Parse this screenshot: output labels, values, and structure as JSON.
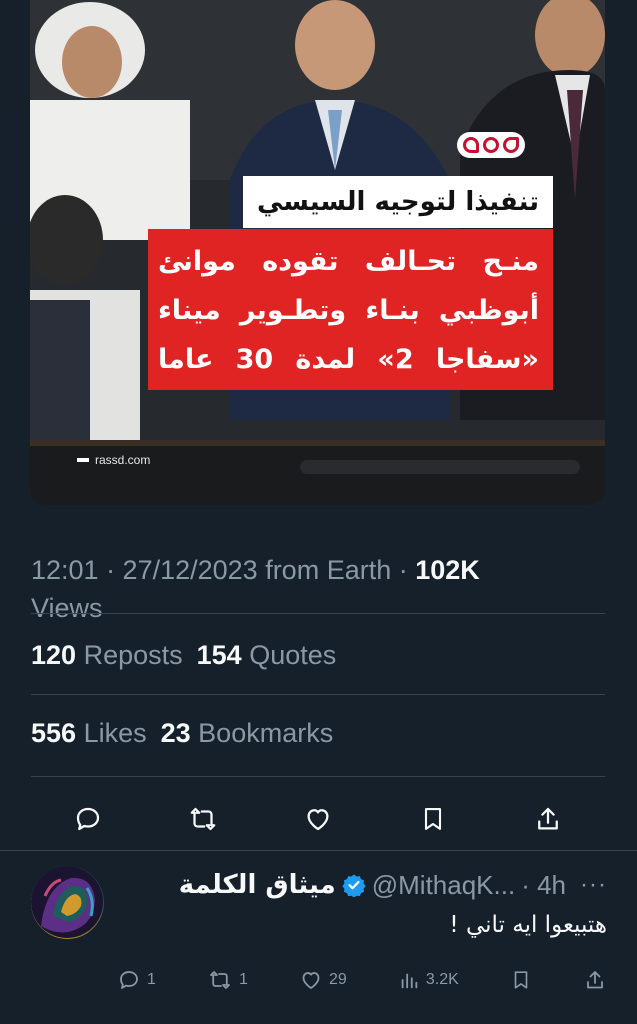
{
  "media": {
    "logo_text": "رصد",
    "headline_tag": "تنفيذا لتوجيه السيسي",
    "body_lines": [
      "منـح تحـالف تقوده موانئ",
      "أبوظبي بنـاء وتطـوير ميناء",
      "«سفاجا 2» لمدة 30 عاما"
    ],
    "watermark": "rassd.com",
    "accent_color": "#e02424"
  },
  "tweet": {
    "timestamp": "12:01 · 27/12/2023 from Earth · ",
    "views_count": "102K",
    "views_label": "Views",
    "reposts_count": "120",
    "reposts_label": "Reposts",
    "quotes_count": "154",
    "quotes_label": "Quotes",
    "likes_count": "556",
    "likes_label": "Likes",
    "bookmarks_count": "23",
    "bookmarks_label": "Bookmarks"
  },
  "action_bar": {
    "icons": [
      "reply-icon",
      "repost-icon",
      "like-icon",
      "bookmark-icon",
      "share-icon"
    ]
  },
  "reply": {
    "name": "ميثاق الكلمة",
    "handle": "@MithaqK...",
    "time": "· 4h",
    "more": "···",
    "text": "هتبيعوا ايه تاني !",
    "replies": "1",
    "reposts": "1",
    "likes": "29",
    "views": "3.2K"
  },
  "colors": {
    "background": "#15202b",
    "text_primary": "#f7f9f9",
    "text_secondary": "#8b98a5",
    "verified": "#1d9bf0"
  }
}
